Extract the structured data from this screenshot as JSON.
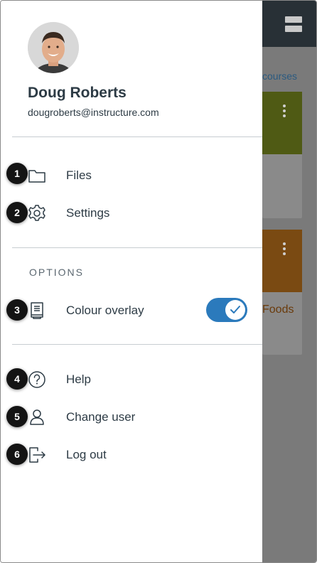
{
  "background": {
    "link_text": "courses",
    "card2_title": "Foods",
    "colors": {
      "topbar": "#283036",
      "card1": "#4f5a14",
      "card2": "#7a4a12"
    }
  },
  "profile": {
    "name": "Doug Roberts",
    "email": "dougroberts@instructure.com"
  },
  "menu": {
    "files": {
      "label": "Files",
      "icon": "folder-icon",
      "badge": "1"
    },
    "settings": {
      "label": "Settings",
      "icon": "gear-icon",
      "badge": "2"
    }
  },
  "options": {
    "heading": "OPTIONS",
    "colour_overlay": {
      "label": "Colour overlay",
      "icon": "book-icon",
      "badge": "3",
      "enabled": true
    }
  },
  "footer_menu": {
    "help": {
      "label": "Help",
      "icon": "question-circle-icon",
      "badge": "4"
    },
    "change_user": {
      "label": "Change user",
      "icon": "user-icon",
      "badge": "5"
    },
    "log_out": {
      "label": "Log out",
      "icon": "logout-icon",
      "badge": "6"
    }
  },
  "accent_color": "#2b7abc",
  "text_color": "#2d3b45"
}
